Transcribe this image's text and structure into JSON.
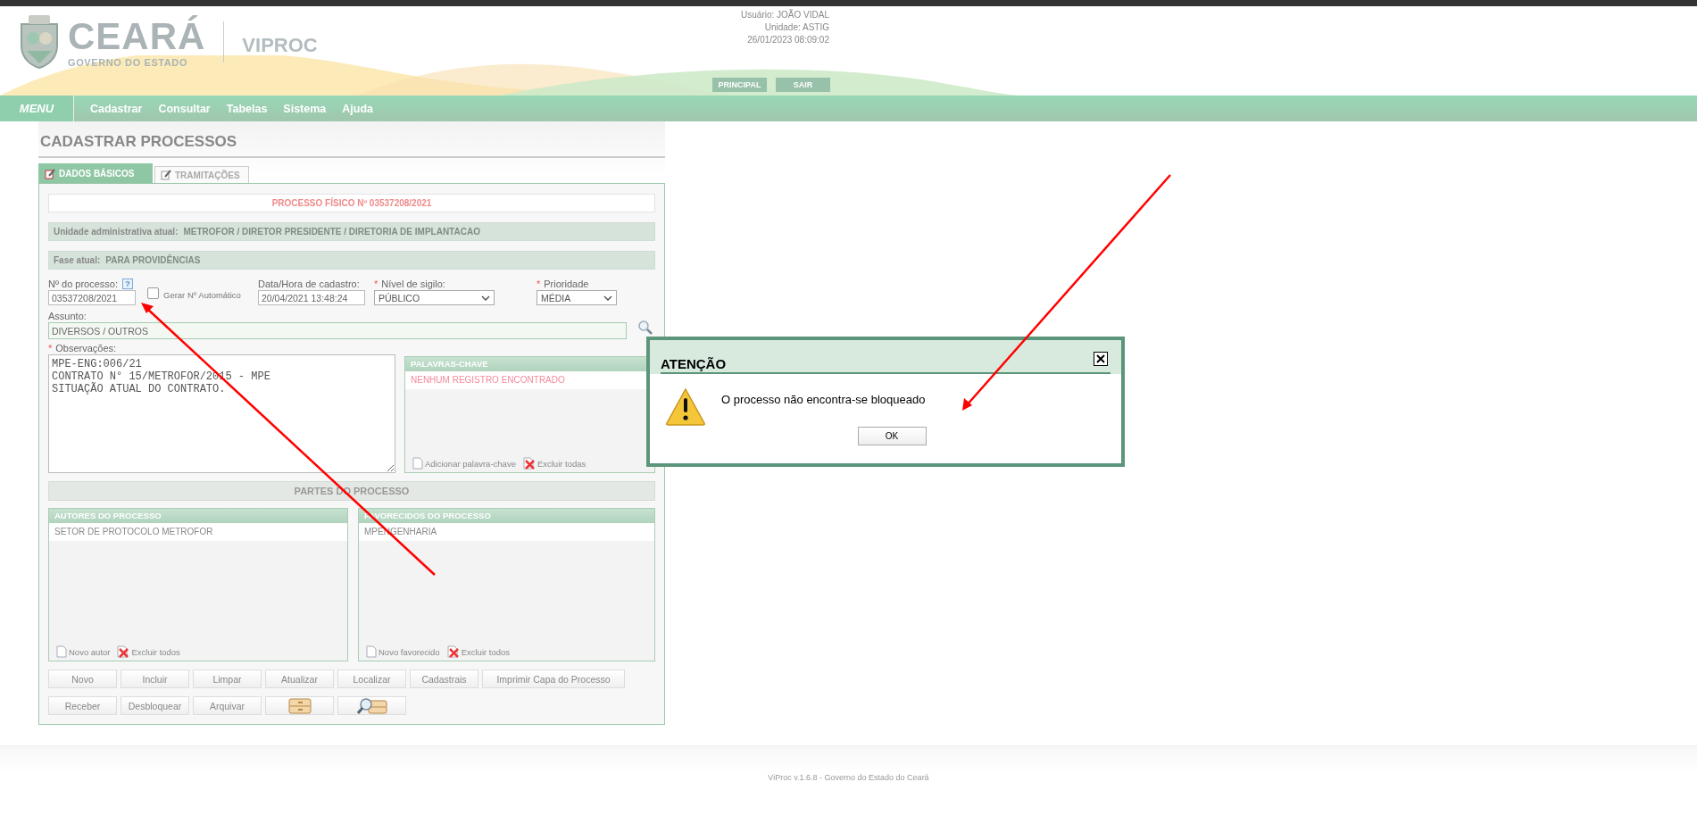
{
  "header": {
    "brand": "CEARÁ",
    "brand_sub": "GOVERNO DO ESTADO",
    "app_name": "VIPROC",
    "user_info": [
      "Usuário: JOÃO VIDAL",
      "Unidade: ASTIG",
      "26/01/2023 08:09:02"
    ],
    "buttons": [
      "PRINCIPAL",
      "SAIR"
    ]
  },
  "menu": {
    "label": "MENU",
    "items": [
      "Cadastrar",
      "Consultar",
      "Tabelas",
      "Sistema",
      "Ajuda"
    ]
  },
  "page_title": "CADASTRAR PROCESSOS",
  "tabs": [
    {
      "label": "DADOS BÁSICOS",
      "selected": true
    },
    {
      "label": "TRAMITAÇÕES",
      "selected": false
    }
  ],
  "form": {
    "process_banner": "PROCESSO FÍSICO Nº 03537208/2021",
    "info_bars": [
      {
        "label": "Unidade administrativa atual:",
        "value": "METROFOR / DIRETOR PRESIDENTE / DIRETORIA DE IMPLANTACAO"
      },
      {
        "label": "Fase atual:",
        "value": "PARA PROVIDÊNCIAS"
      }
    ],
    "process_number": {
      "label": "Nº do processo:",
      "help": "?",
      "value": "03537208/2021"
    },
    "auto_number": {
      "label": "Gerar Nº Automático",
      "checked": false
    },
    "created_at": {
      "label": "Data/Hora de cadastro:",
      "value": "20/04/2021 13:48:24"
    },
    "secrecy": {
      "label": "Nível de sigilo:",
      "required_mark": "*",
      "value": "PÚBLICO"
    },
    "priority": {
      "label": "Prioridade",
      "required_mark": "*",
      "value": "MÉDIA"
    },
    "subject": {
      "label": "Assunto:",
      "value": "DIVERSOS / OUTROS"
    },
    "notes": {
      "label": "Observações:",
      "required_mark": "*",
      "value": "MPE-ENG:006/21\nCONTRATO N° 15/METROFOR/2015 - MPE\nSITUAÇÃO ATUAL DO CONTRATO."
    },
    "keywords": {
      "title": "PALAVRAS-CHAVE",
      "empty_message": "NENHUM REGISTRO ENCONTRADO",
      "actions": [
        {
          "kind": "add",
          "label": "Adicionar palavra-chave"
        },
        {
          "kind": "delete",
          "label": "Excluir todas"
        }
      ]
    },
    "parties_title": "PARTES DO PROCESSO",
    "parties": [
      {
        "title": "AUTORES DO PROCESSO",
        "rows": [
          "SETOR DE PROTOCOLO METROFOR"
        ],
        "actions": [
          {
            "kind": "add",
            "label": "Novo autor"
          },
          {
            "kind": "delete",
            "label": "Excluir todos"
          }
        ]
      },
      {
        "title": "FAVORECIDOS DO PROCESSO",
        "rows": [
          "MPENGENHARIA"
        ],
        "actions": [
          {
            "kind": "add",
            "label": "Novo favorecido"
          },
          {
            "kind": "delete",
            "label": "Excluir todos"
          }
        ]
      }
    ],
    "button_rows": [
      [
        {
          "kind": "text",
          "label": "Novo"
        },
        {
          "kind": "text",
          "label": "Incluir"
        },
        {
          "kind": "text",
          "label": "Limpar"
        },
        {
          "kind": "text",
          "label": "Atualizar"
        },
        {
          "kind": "text",
          "label": "Localizar"
        },
        {
          "kind": "text",
          "label": "Cadastrais"
        },
        {
          "kind": "wide",
          "label": "Imprimir Capa do Processo"
        }
      ],
      [
        {
          "kind": "text",
          "label": "Receber"
        },
        {
          "kind": "text",
          "label": "Desbloquear"
        },
        {
          "kind": "text",
          "label": "Arquivar"
        },
        {
          "kind": "archive"
        },
        {
          "kind": "lookup"
        }
      ]
    ]
  },
  "dialog": {
    "title": "ATENÇÃO",
    "message": "O processo não encontra-se bloqueado",
    "button": "OK"
  },
  "footer": "ViProc v.1.6.8 - Governo do Estado do Ceará"
}
